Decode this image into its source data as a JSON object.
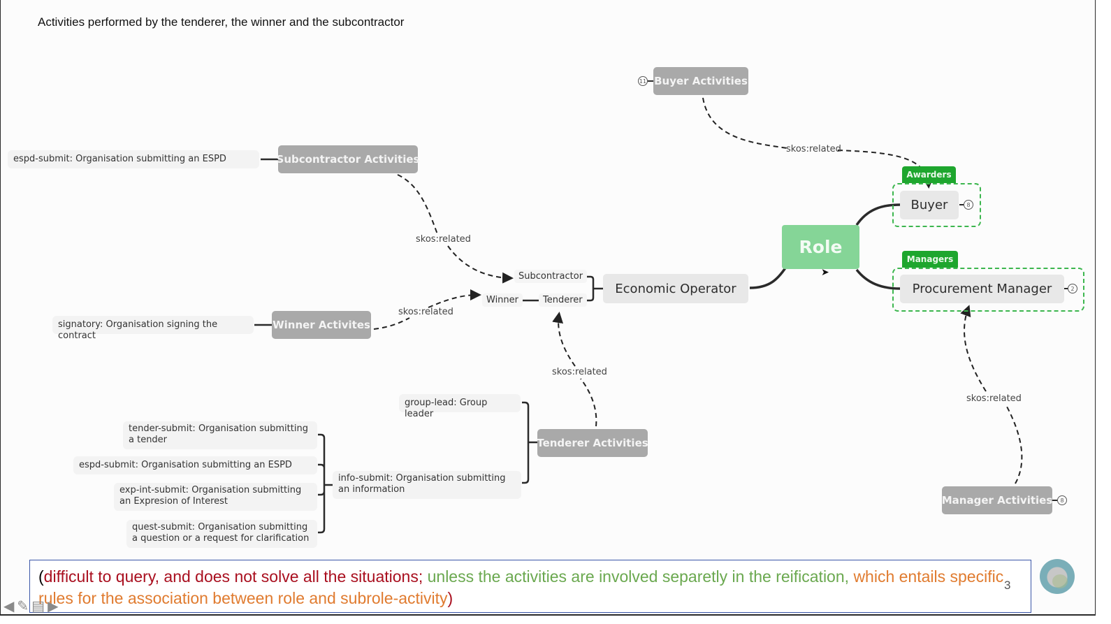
{
  "slide": {
    "title": "Activities performed by the tenderer, the winner and the subcontractor",
    "page_number": "3"
  },
  "mindmap": {
    "root": {
      "label": "Role",
      "color": "#85d597"
    },
    "buyer_group": {
      "tag": "Awarders",
      "node": "Buyer",
      "badge": "8"
    },
    "manager_group": {
      "tag": "Managers",
      "node": "Procurement Manager",
      "badge": "2"
    },
    "economic_operator": {
      "label": "Economic Operator",
      "subroles": {
        "subcontractor": "Subcontractor",
        "winner": "Winner",
        "tenderer": "Tenderer"
      }
    },
    "buyer_activities": {
      "label": "Buyer Activities",
      "badge": "11"
    },
    "manager_activities": {
      "label": "Manager Activities",
      "badge": "8"
    },
    "subcontractor_activities": {
      "label": "Subcontractor Activities",
      "items": [
        "espd-submit: Organisation submitting an ESPD"
      ]
    },
    "winner_activities": {
      "label": "Winner Activites",
      "items": [
        "signatory: Organisation signing the contract"
      ]
    },
    "tenderer_activities": {
      "label": "Tenderer Activities",
      "items": [
        "group-lead: Group leader",
        "info-submit: Organisation submitting an information"
      ],
      "info_submit_children": [
        "tender-submit: Organisation submitting a tender",
        "espd-submit: Organisation submitting an ESPD",
        "exp-int-submit: Organisation submitting an Expresion of Interest",
        "quest-submit: Organisation submitting a question or a request for clarification"
      ]
    },
    "relation_label": "skos:related"
  },
  "note": {
    "open": "(",
    "red_text": "difficult to query, and does not solve all the situations; ",
    "green_text": "unless the activities are involved separetly in the reification, ",
    "orange_text": "which entails specific rules for the association between role and subrole-activity",
    "close": ")"
  },
  "nav": {
    "prev": "prev-arrow",
    "pen": "pen-icon",
    "menu": "menu-icon",
    "next": "next-arrow"
  }
}
